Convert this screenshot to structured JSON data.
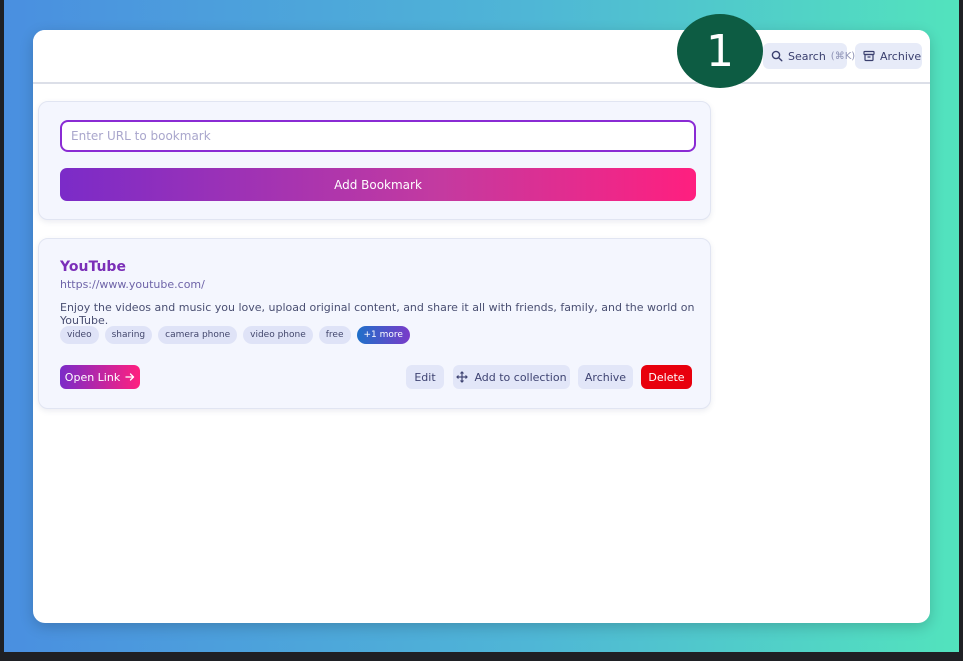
{
  "header": {
    "step_number": "1",
    "search_label": "Search",
    "search_shortcut": "(⌘K)",
    "archive_label": "Archive"
  },
  "add_form": {
    "url_placeholder": "Enter URL to bookmark",
    "url_value": "",
    "add_button_label": "Add Bookmark"
  },
  "bookmark": {
    "title": "YouTube",
    "url": "https://www.youtube.com/",
    "description": "Enjoy the videos and music you love, upload original content, and share it all with friends, family, and the world on YouTube.",
    "tags": [
      "video",
      "sharing",
      "camera phone",
      "video phone",
      "free"
    ],
    "more_tags_label": "+1 more",
    "actions": {
      "open_label": "Open Link",
      "edit_label": "Edit",
      "collection_label": "Add to collection",
      "archive_label": "Archive",
      "delete_label": "Delete"
    }
  },
  "colors": {
    "accent_purple": "#7b2bc8",
    "accent_pink": "#ff1f7f",
    "delete_red": "#e8000d",
    "step_badge": "#0d5c43"
  },
  "icons": [
    "search-icon",
    "archive-icon",
    "arrow-right-icon",
    "move-icon"
  ]
}
